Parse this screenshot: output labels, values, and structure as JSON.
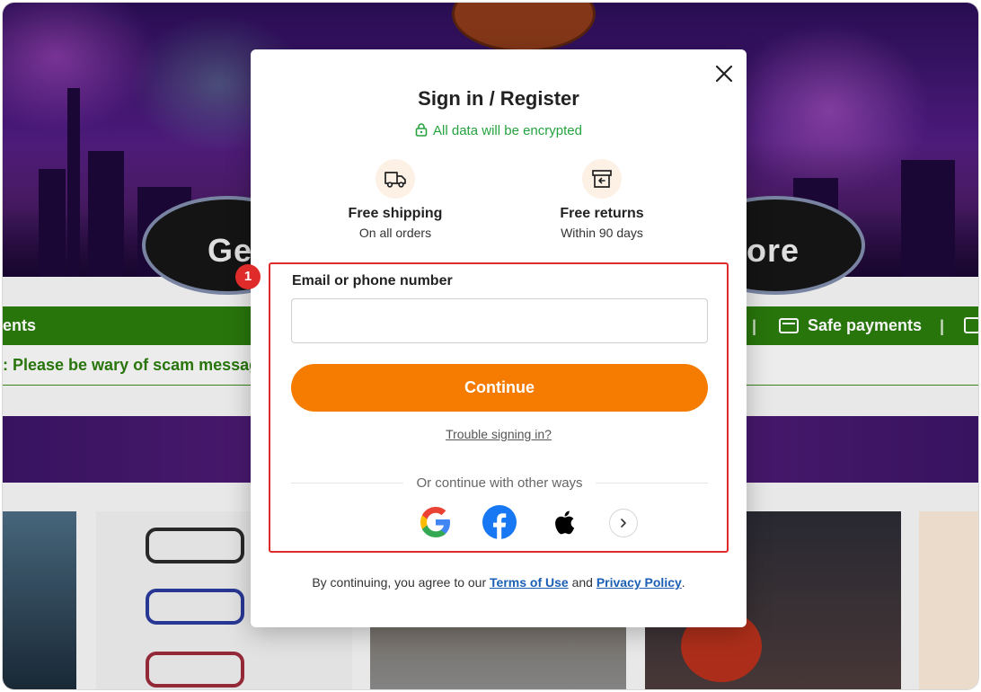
{
  "background": {
    "hero_text_left": "Get",
    "hero_text_right": "ore",
    "green_bar_left": "ents",
    "green_bar_safe_payments": "Safe payments",
    "separator": "|",
    "notice": ": Please be wary of scam messag"
  },
  "modal": {
    "title": "Sign in / Register",
    "encrypt_note": "All data will be encrypted",
    "perks": [
      {
        "title": "Free shipping",
        "subtitle": "On all orders",
        "icon": "truck-icon"
      },
      {
        "title": "Free returns",
        "subtitle": "Within 90 days",
        "icon": "return-box-icon"
      }
    ],
    "step_badge": "1",
    "email_label": "Email or phone number",
    "email_value": "",
    "email_placeholder": "",
    "continue_label": "Continue",
    "trouble_link": "Trouble signing in?",
    "or_text": "Or continue with other ways",
    "social": [
      "google-icon",
      "facebook-icon",
      "apple-icon",
      "chevron-right-icon"
    ],
    "terms_prefix": "By continuing, you agree to our ",
    "terms_link": "Terms of Use",
    "terms_and": " and ",
    "privacy_link": "Privacy Policy",
    "terms_suffix": "."
  },
  "colors": {
    "accent_orange": "#f57c00",
    "encrypt_green": "#25a33e",
    "highlight_red": "#e02b2b",
    "banner_green": "#2a7a0c",
    "link_blue": "#1a5fb4"
  }
}
